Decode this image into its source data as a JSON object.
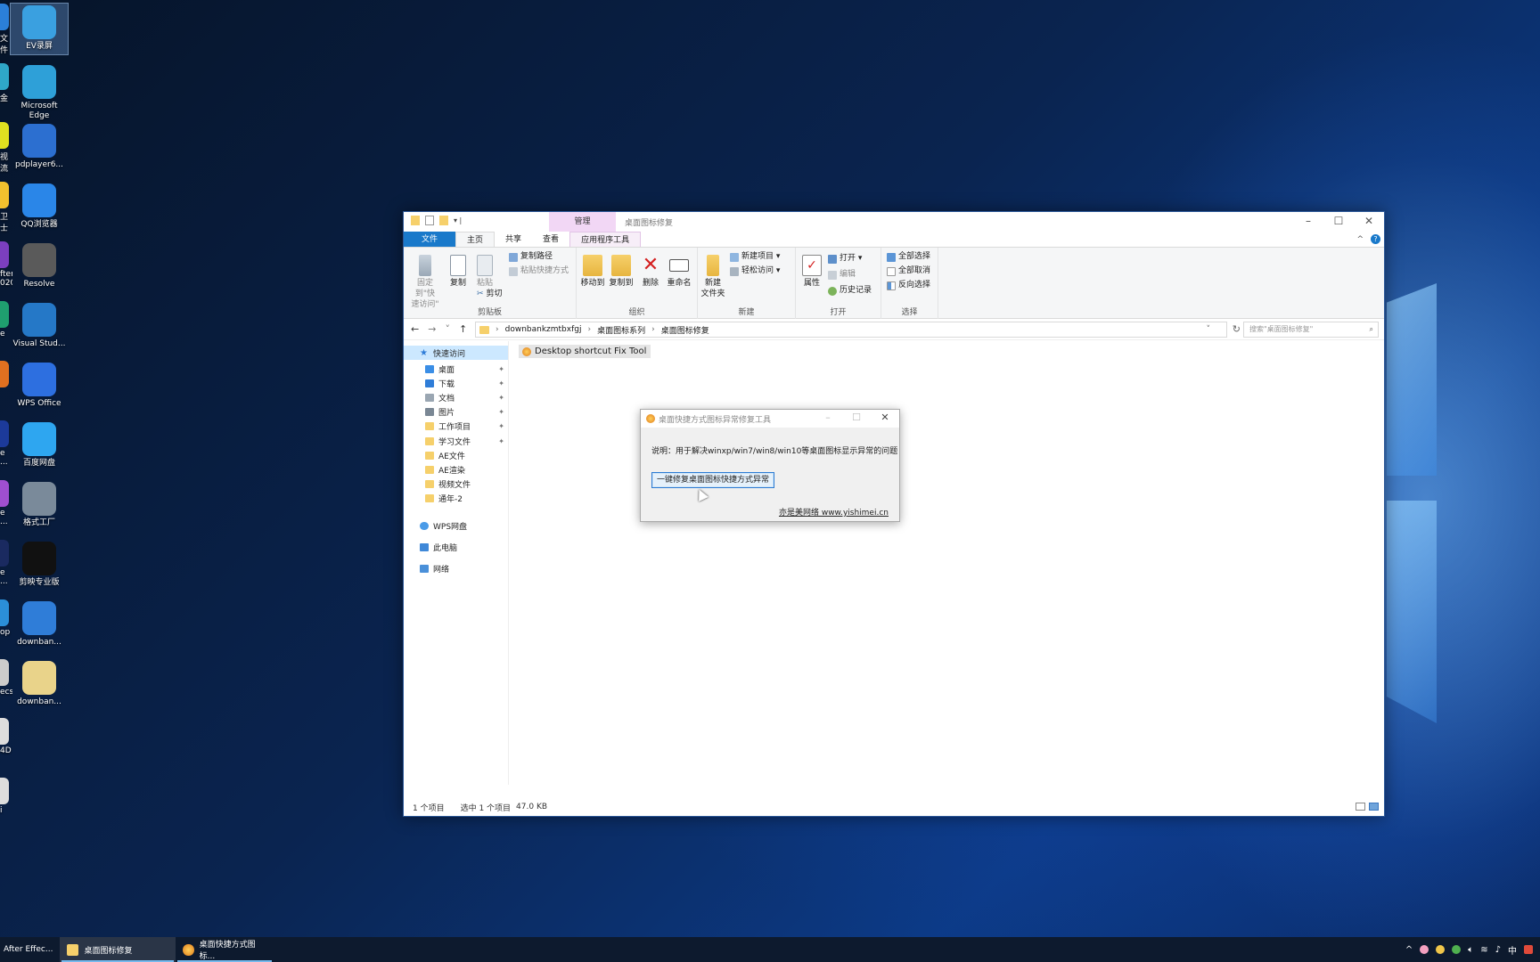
{
  "desktop": {
    "icons": [
      {
        "label": "EV录屏",
        "color": "#3aa0e0"
      },
      {
        "label": "Microsoft Edge",
        "color": "#2ea0d8"
      },
      {
        "label": "pdplayer6...",
        "color": "#2c6fd0"
      },
      {
        "label": "QQ浏览器",
        "color": "#2a86e8"
      },
      {
        "label": "Resolve",
        "color": "#5a5a5a"
      },
      {
        "label": "Visual Stud...",
        "color": "#2578c7"
      },
      {
        "label": "WPS Office",
        "color": "#2d6fe0"
      },
      {
        "label": "百度网盘",
        "color": "#2ea6f0"
      },
      {
        "label": "格式工厂",
        "color": "#7a8a9a"
      },
      {
        "label": "剪映专业版",
        "color": "#111111"
      },
      {
        "label": "downban...",
        "color": "#2f7dd8"
      },
      {
        "label": "downban...",
        "color": "#e9d38a"
      }
    ],
    "left_fragments": [
      "文\n件",
      "金",
      "视流",
      "卫士",
      "fter\n020",
      "e",
      "",
      "e\n...",
      "e\n...",
      "e\n...",
      "op",
      "ecs",
      "4D",
      "i"
    ]
  },
  "explorer": {
    "title": "桌面图标修复",
    "manage_tab": "管理",
    "tabs": [
      "文件",
      "主页",
      "共享",
      "查看",
      "应用程序工具"
    ],
    "ribbon": {
      "clipboard": {
        "pin": "固定到\"快\n速访问\"",
        "copy": "复制",
        "paste": "粘贴",
        "copy_path": "复制路径",
        "paste_shortcut": "粘贴快捷方式",
        "cut": "剪切",
        "label": "剪贴板"
      },
      "organize": {
        "move_to": "移动到",
        "copy_to": "复制到",
        "delete": "删除",
        "rename": "重命名",
        "label": "组织"
      },
      "new": {
        "new_folder": "新建\n文件夹",
        "new_item": "新建项目 ▾",
        "easy_access": "轻松访问 ▾",
        "label": "新建"
      },
      "open": {
        "properties": "属性",
        "open": "打开 ▾",
        "edit": "编辑",
        "history": "历史记录",
        "label": "打开"
      },
      "select": {
        "select_all": "全部选择",
        "select_none": "全部取消",
        "invert": "反向选择",
        "label": "选择"
      }
    },
    "address": {
      "crumbs": [
        "downbankzmtbxfgj",
        "桌面图标系列",
        "桌面图标修复"
      ],
      "search_placeholder": "搜索\"桌面图标修复\""
    },
    "nav": {
      "quick_access": "快速访问",
      "items": [
        {
          "label": "桌面",
          "color": "#3a8ee6",
          "pinned": true
        },
        {
          "label": "下载",
          "color": "#2f7dd8",
          "pinned": true
        },
        {
          "label": "文档",
          "color": "#9aa6b2",
          "pinned": true
        },
        {
          "label": "图片",
          "color": "#7a8794",
          "pinned": true
        },
        {
          "label": "工作项目",
          "color": "#f6d06b",
          "pinned": true
        },
        {
          "label": "学习文件",
          "color": "#f6d06b",
          "pinned": true
        },
        {
          "label": "AE文件",
          "color": "#f6d06b",
          "pinned": false
        },
        {
          "label": "AE渲染",
          "color": "#f6d06b",
          "pinned": false
        },
        {
          "label": "视频文件",
          "color": "#f6d06b",
          "pinned": false
        },
        {
          "label": "通年-2",
          "color": "#f6d06b",
          "pinned": false
        }
      ],
      "wps": "WPS网盘",
      "this_pc": "此电脑",
      "network": "网络"
    },
    "file": {
      "name": "Desktop shortcut Fix Tool"
    },
    "status": {
      "count": "1 个项目",
      "selected": "选中 1 个项目",
      "size": "47.0 KB"
    }
  },
  "dialog": {
    "title": "桌面快捷方式图标异常修复工具",
    "description": "说明：用于解决winxp/win7/win8/win10等桌面图标显示异常的问题",
    "fix_button": "一键修复桌面图标快捷方式异常",
    "link": "亦是美网络 www.yishimei.cn"
  },
  "taskbar": {
    "tasks": [
      {
        "label": "After Effec..."
      },
      {
        "label": "桌面图标修复"
      },
      {
        "label": "桌面快捷方式图标..."
      }
    ],
    "ime": "中"
  }
}
